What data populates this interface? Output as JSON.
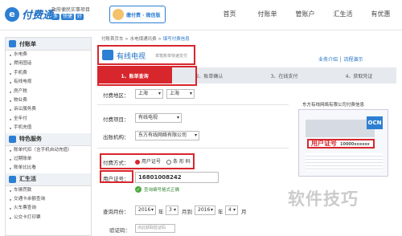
{
  "header": {
    "logo_mark": "e",
    "logo_text": "付费通",
    "logo_line1": "政府便民实事项目",
    "logo_line2": [
      "多",
      "快捷",
      "好"
    ],
    "promo_text": "缴付费 · 微信版",
    "nav": [
      "首页",
      "付账单",
      "管账户",
      "汇生活",
      "有优惠"
    ]
  },
  "sidebar": {
    "sections": [
      {
        "title": "付账单",
        "items": [
          "水电费",
          "燃用固话",
          "手机费",
          "有线电视",
          "房产税",
          "物业费",
          "诉讼服务费",
          "全年付",
          "手机充值"
        ]
      },
      {
        "title": "特色服务",
        "items": [
          "账单代扣（含手机自动充值）",
          "过期账单",
          "账单比比看"
        ]
      },
      {
        "title": "汇生活",
        "items": [
          "车辆罚款",
          "交通卡余额查询",
          "火车票查询",
          "公交卡打印票"
        ]
      }
    ]
  },
  "breadcrumb": {
    "a": "付账首页车",
    "b": "水电煤通讯费",
    "c": "填写付费信息"
  },
  "page": {
    "title": "有线电视",
    "hint": "单笔账单快速支付",
    "help": "业务介绍 │ 流程演示"
  },
  "steps": [
    "1、账单查询",
    "2、账单确认",
    "3、在线支付",
    "4、获取凭证"
  ],
  "form": {
    "region_label": "付费地区：",
    "region_1": "上海",
    "region_2": "上海",
    "item_label": "付费项目：",
    "item_value": "有线电视",
    "org_label": "出账机构：",
    "org_value": "东方有线网络有限公司",
    "pay_label": "付费方式：",
    "pay_opt1": "用户证号",
    "pay_opt2": "条 形 码",
    "user_label": "用户证号：",
    "user_value": "16801008242",
    "ok_tip": "查询编号格式正确",
    "month_label": "查询月份：",
    "y1": "2016",
    "y_unit": "年",
    "m1": "3",
    "m_unit": "月到",
    "y2": "2016",
    "m2": "4",
    "m_unit2": "月",
    "captcha_label": "验证码：",
    "captcha_hint": "点此获取验证码"
  },
  "card": {
    "caption": "东方有线网络有限公司付费信息",
    "badge": "OCN",
    "highlight": "用户证号",
    "highlight_sub": "10000xxxxxx"
  },
  "watermark": "软件技巧"
}
